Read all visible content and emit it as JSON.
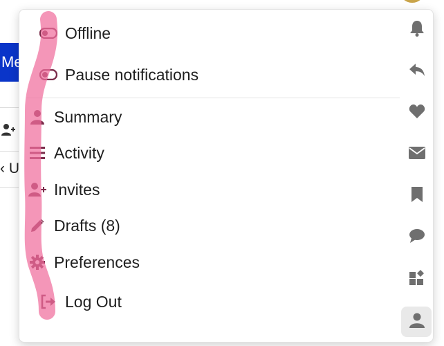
{
  "background": {
    "button_label": "Me",
    "row_fragment": "U"
  },
  "menu": {
    "status_items": [
      {
        "label": "Offline",
        "icon": "toggle-off-icon"
      },
      {
        "label": "Pause notifications",
        "icon": "toggle-off-icon"
      }
    ],
    "items": [
      {
        "label": "Summary",
        "icon": "user-icon"
      },
      {
        "label": "Activity",
        "icon": "list-lines-icon"
      },
      {
        "label": "Invites",
        "icon": "user-plus-icon"
      },
      {
        "label": "Drafts (8)",
        "icon": "pencil-icon"
      },
      {
        "label": "Preferences",
        "icon": "gear-icon"
      }
    ],
    "logout": {
      "label": "Log Out",
      "icon": "sign-out-icon"
    }
  },
  "rail": [
    "bell-icon",
    "reply-icon",
    "heart-icon",
    "envelope-icon",
    "bookmark-icon",
    "chat-bubble-icon",
    "grid-shapes-icon",
    "user-icon"
  ],
  "colors": {
    "icon": "#7a2c4a",
    "rail_icon": "#6f6f6f",
    "highlight": "#f06e9c",
    "bg_button": "#0a35c9"
  }
}
